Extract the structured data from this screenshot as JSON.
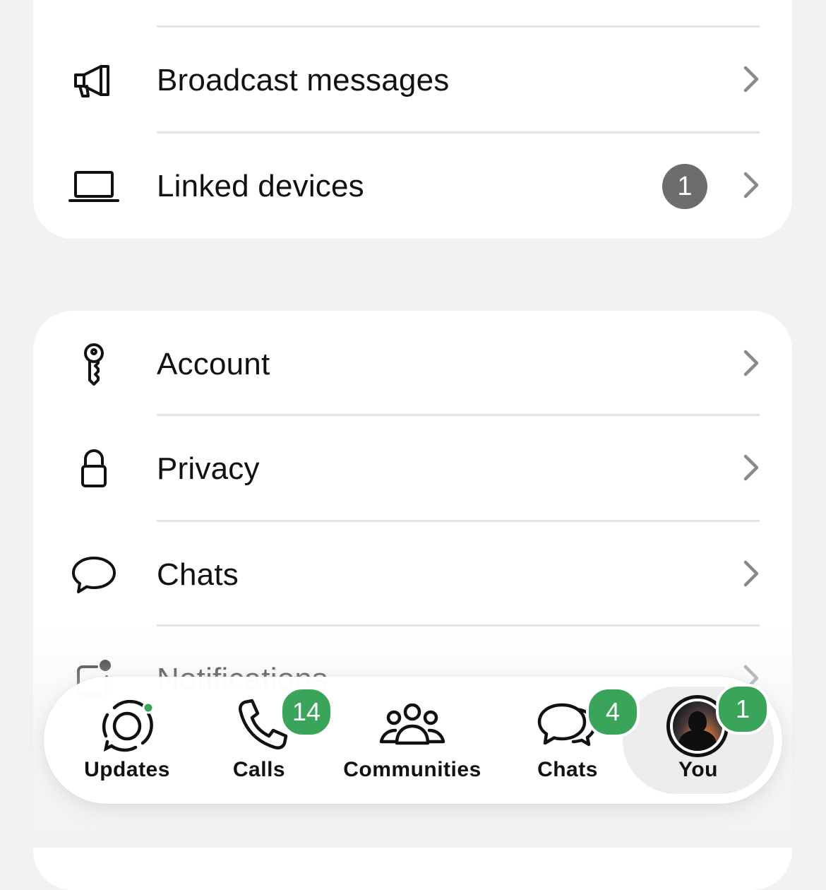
{
  "settings_top": {
    "items": [
      {
        "label": "Broadcast messages",
        "icon": "megaphone-icon"
      },
      {
        "label": "Linked devices",
        "icon": "laptop-icon",
        "badge": "1"
      }
    ]
  },
  "settings_main": {
    "items": [
      {
        "label": "Account",
        "icon": "key-icon"
      },
      {
        "label": "Privacy",
        "icon": "lock-icon"
      },
      {
        "label": "Chats",
        "icon": "chat-bubble-icon"
      },
      {
        "label": "Notifications",
        "icon": "notification-icon"
      }
    ]
  },
  "tabbar": {
    "tabs": [
      {
        "label": "Updates",
        "icon": "updates-icon",
        "dot_color": "#3aa45b"
      },
      {
        "label": "Calls",
        "icon": "phone-icon",
        "badge": "14"
      },
      {
        "label": "Communities",
        "icon": "communities-icon"
      },
      {
        "label": "Chats",
        "icon": "chats-icon",
        "badge": "4"
      },
      {
        "label": "You",
        "icon": "avatar",
        "badge": "1",
        "active": true
      }
    ]
  },
  "colors": {
    "accent_green": "#3aa45b",
    "badge_gray": "#6d6d6f",
    "background": "#f2f2f2",
    "card": "#ffffff"
  }
}
